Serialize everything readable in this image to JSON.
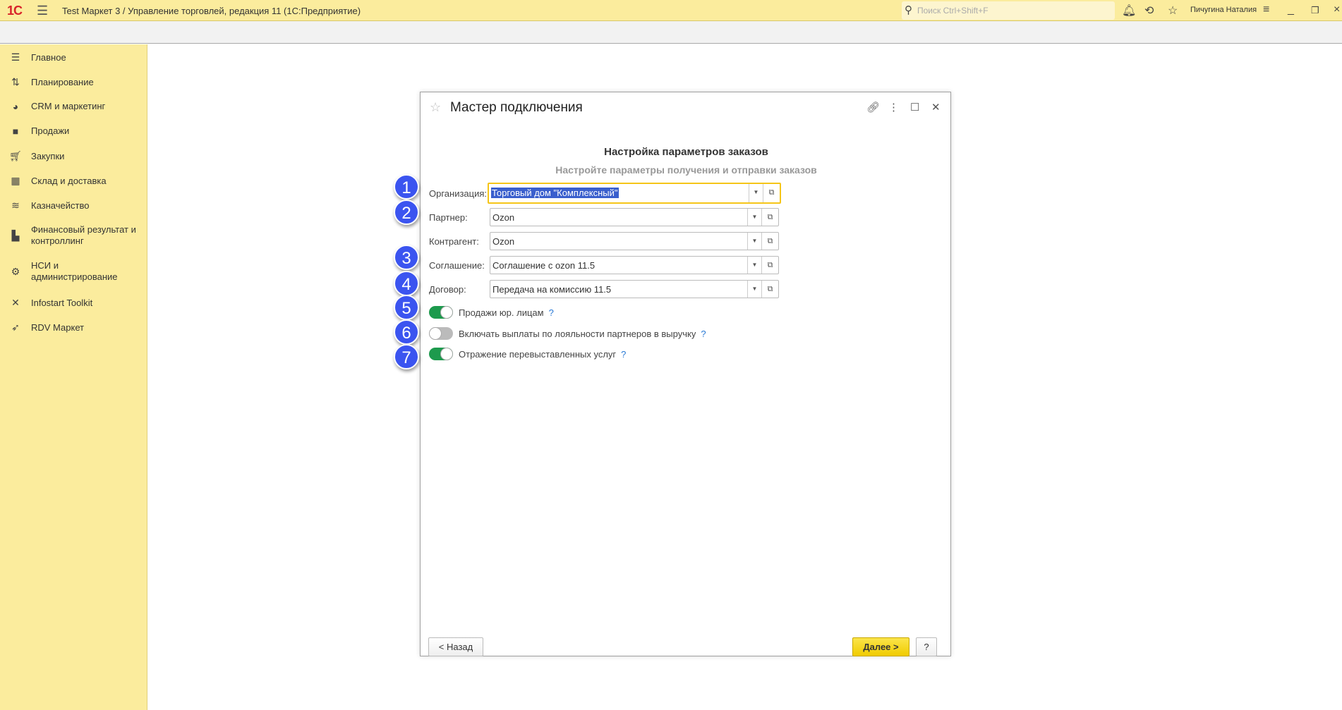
{
  "topbar": {
    "logo": "1С",
    "title": "Test Маркет 3 / Управление торговлей, редакция 11  (1С:Предприятие)",
    "search_placeholder": "Поиск Ctrl+Shift+F",
    "user": "Пичугина Наталия"
  },
  "sidebar": {
    "items": [
      {
        "label": "Главное",
        "icon": "menu-icon"
      },
      {
        "label": "Планирование",
        "icon": "planning-icon"
      },
      {
        "label": "CRM и маркетинг",
        "icon": "pie-chart-icon"
      },
      {
        "label": "Продажи",
        "icon": "bag-icon"
      },
      {
        "label": "Закупки",
        "icon": "cart-icon"
      },
      {
        "label": "Склад и доставка",
        "icon": "warehouse-icon"
      },
      {
        "label": "Казначейство",
        "icon": "coins-icon"
      },
      {
        "label": "Финансовый результат и контроллинг",
        "icon": "bar-chart-icon"
      },
      {
        "label": "НСИ и администрирование",
        "icon": "gear-icon"
      },
      {
        "label": "Infostart Toolkit",
        "icon": "tools-icon"
      },
      {
        "label": "RDV Маркет",
        "icon": "rocket-icon"
      }
    ]
  },
  "dialog": {
    "title": "Мастер подключения",
    "heading": "Настройка параметров заказов",
    "subheading": "Настройте параметры получения и отправки заказов",
    "fields": [
      {
        "label": "Организация:",
        "value": "Торговый дом \"Комплексный\""
      },
      {
        "label": "Партнер:",
        "value": "Ozon"
      },
      {
        "label": "Контрагент:",
        "value": "Ozon"
      },
      {
        "label": "Соглашение:",
        "value": "Соглашение с ozon 11.5"
      },
      {
        "label": "Договор:",
        "value": "Передача на комиссию 11.5"
      }
    ],
    "toggles": [
      {
        "label": "Продажи юр. лицам",
        "on": true,
        "help": "?"
      },
      {
        "label": "Включать выплаты по лояльности партнеров в выручку",
        "on": false,
        "help": "?"
      },
      {
        "label": "Отражение перевыставленных услуг",
        "on": true,
        "help": "?"
      }
    ],
    "back_label": "< Назад",
    "next_label": "Далее >",
    "help_label": "?"
  },
  "badges": [
    "1",
    "2",
    "3",
    "4",
    "5",
    "6",
    "7"
  ]
}
